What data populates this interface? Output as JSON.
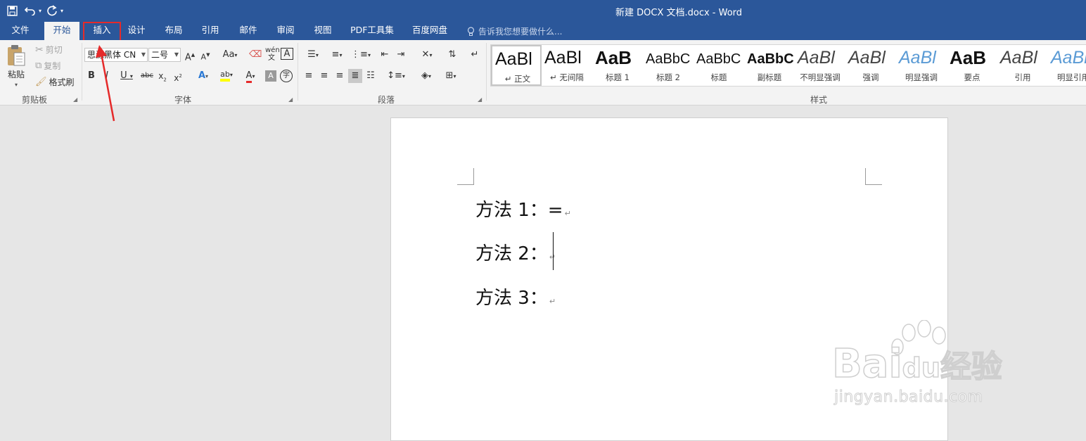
{
  "window": {
    "title": "新建 DOCX 文档.docx - Word"
  },
  "quick_access": {
    "save_icon": "save-icon",
    "undo_icon": "undo-icon",
    "redo_icon": "redo-icon",
    "customize_icon": "customize-qat-icon"
  },
  "tabs": [
    {
      "label": "文件"
    },
    {
      "label": "开始"
    },
    {
      "label": "插入"
    },
    {
      "label": "设计"
    },
    {
      "label": "布局"
    },
    {
      "label": "引用"
    },
    {
      "label": "邮件"
    },
    {
      "label": "审阅"
    },
    {
      "label": "视图"
    },
    {
      "label": "PDF工具集"
    },
    {
      "label": "百度网盘"
    }
  ],
  "active_tab": "开始",
  "highlighted_tab": "插入",
  "tell_me": {
    "placeholder": "告诉我您想要做什么..."
  },
  "clipboard": {
    "paste": "粘贴",
    "cut": "剪切",
    "copy": "复制",
    "format_painter": "格式刷",
    "group": "剪贴板"
  },
  "font": {
    "font_name": "思源黑体 CN",
    "font_size": "二号",
    "group": "字体"
  },
  "paragraph": {
    "group": "段落"
  },
  "styles": {
    "group": "样式",
    "items": [
      {
        "sample": "AaBl",
        "name": "↵ 正文"
      },
      {
        "sample": "AaBl",
        "name": "↵ 无间隔"
      },
      {
        "sample": "AaB",
        "name": "标题 1"
      },
      {
        "sample": "AaBbC",
        "name": "标题 2"
      },
      {
        "sample": "AaBbC",
        "name": "标题"
      },
      {
        "sample": "AaBbC",
        "name": "副标题"
      },
      {
        "sample": "AaBl",
        "name": "不明显强调"
      },
      {
        "sample": "AaBl",
        "name": "强调"
      },
      {
        "sample": "AaBl",
        "name": "明显强调"
      },
      {
        "sample": "AaB",
        "name": "要点"
      },
      {
        "sample": "AaBl",
        "name": "引用"
      },
      {
        "sample": "AaBl",
        "name": "明显引用"
      }
    ]
  },
  "document": {
    "lines": [
      {
        "text": "方法 1：="
      },
      {
        "text": "方法 2："
      },
      {
        "text": "方法 3："
      }
    ],
    "paragraph_mark": "↵"
  },
  "watermark": {
    "brand": "Bai",
    "brand_du": "du",
    "brand_cn": "经验",
    "url": "jingyan.baidu.com"
  },
  "colors": {
    "title_bar": "#2b579a",
    "ribbon": "#f3f3f3",
    "highlight": "#e52a2a",
    "workspace": "#e6e6e6"
  }
}
